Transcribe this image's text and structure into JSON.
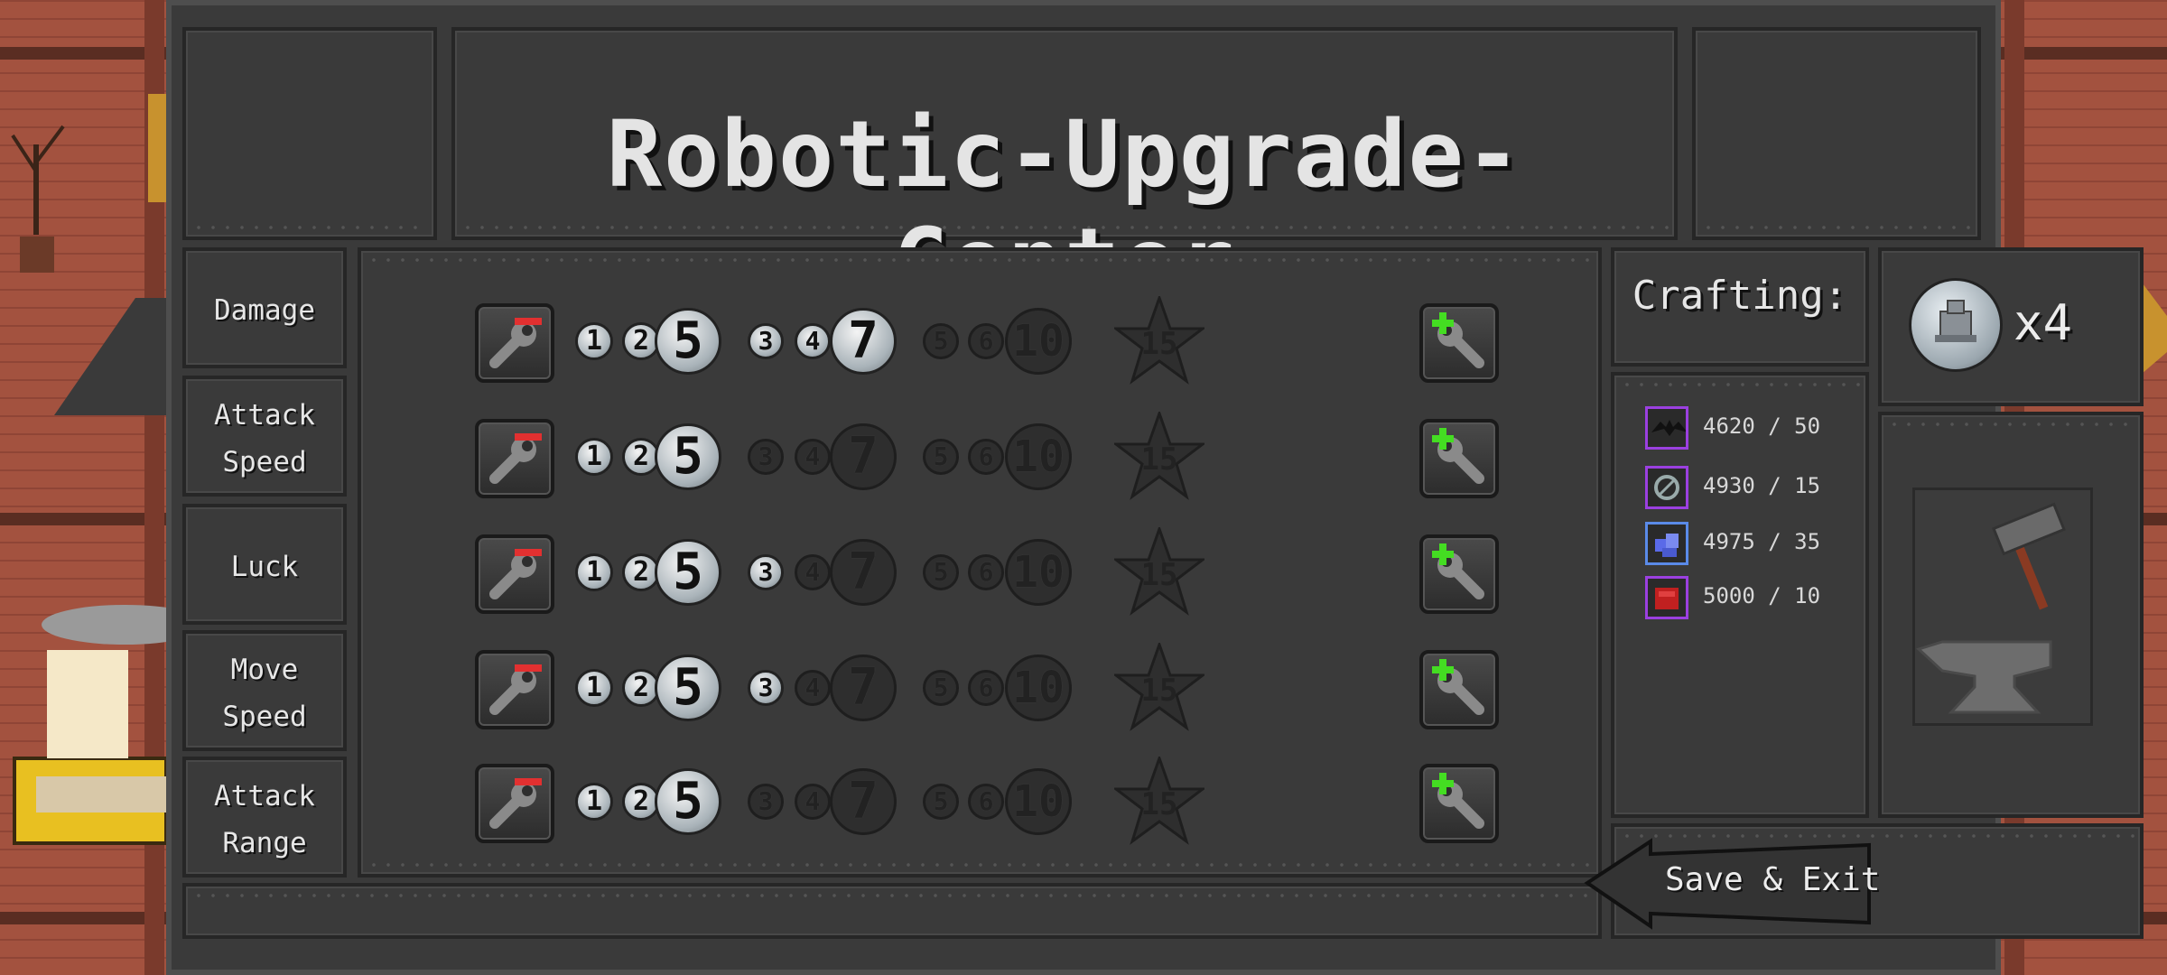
{
  "title": "Robotic-Upgrade-Center",
  "stats": [
    {
      "label_line1": "Damage",
      "label_line2": "",
      "active_levels": [
        1,
        2,
        5,
        3,
        4,
        7
      ]
    },
    {
      "label_line1": "Attack",
      "label_line2": "Speed",
      "active_levels": [
        1,
        2,
        5
      ]
    },
    {
      "label_line1": "Luck",
      "label_line2": "",
      "active_levels": [
        1,
        2,
        5,
        3
      ]
    },
    {
      "label_line1": "Move",
      "label_line2": "Speed",
      "active_levels": [
        1,
        2,
        5,
        3
      ]
    },
    {
      "label_line1": "Attack",
      "label_line2": "Range",
      "active_levels": [
        1,
        2,
        5
      ]
    }
  ],
  "level_labels": [
    "1",
    "2",
    "5",
    "3",
    "4",
    "7",
    "5",
    "6",
    "10",
    "15"
  ],
  "crafting": {
    "title": "Crafting:",
    "materials": [
      {
        "icon": "bat-icon",
        "text": "4620 / 50",
        "frame_color": "#9b40e0"
      },
      {
        "icon": "gear-icon",
        "text": "4930 / 15",
        "frame_color": "#9b40e0"
      },
      {
        "icon": "ore-icon",
        "text": "4975 / 35",
        "frame_color": "#5a8ae8"
      },
      {
        "icon": "ruby-icon",
        "text": "5000 / 10",
        "frame_color": "#9b40e0"
      }
    ]
  },
  "robot_count": "x4",
  "exit_label": "Save & Exit",
  "colors": {
    "minus": "#e23030",
    "plus": "#44dd22",
    "panel": "#3a3a3a"
  }
}
